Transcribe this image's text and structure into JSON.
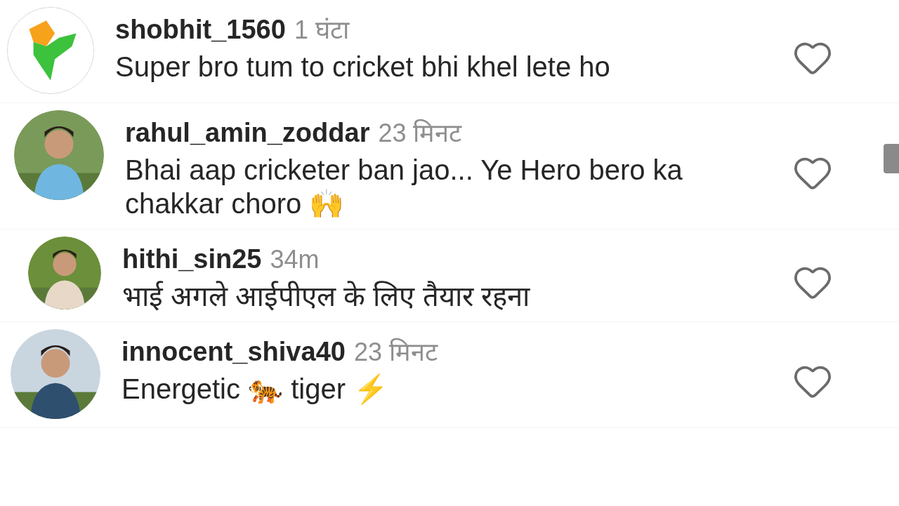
{
  "comments": [
    {
      "username": "shobhit_1560",
      "time": "1 घंटा",
      "text": "Super bro tum to cricket bhi khel lete ho"
    },
    {
      "username": "rahul_amin_zoddar",
      "time": "23 मिनट",
      "text": "Bhai aap cricketer ban jao... Ye Hero bero ka chakkar choro 🙌"
    },
    {
      "username": "hithi_sin25",
      "time": "34m",
      "text": "भाई अगले आईपीएल के लिए तैयार रहना"
    },
    {
      "username": "innocent_shiva40",
      "time": "23 मिनट",
      "text": "Energetic 🐅 tiger ⚡"
    }
  ]
}
